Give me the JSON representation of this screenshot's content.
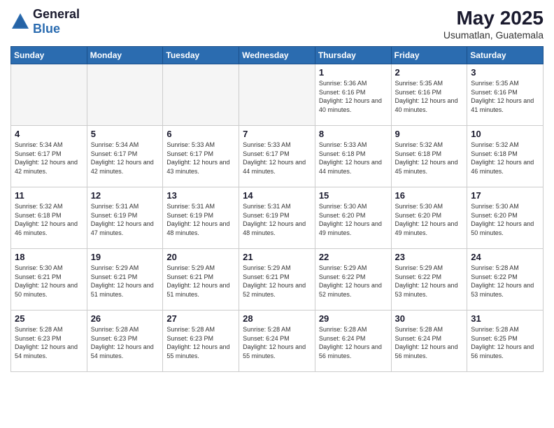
{
  "logo": {
    "general": "General",
    "blue": "Blue"
  },
  "header": {
    "title": "May 2025",
    "subtitle": "Usumatlan, Guatemala"
  },
  "days_of_week": [
    "Sunday",
    "Monday",
    "Tuesday",
    "Wednesday",
    "Thursday",
    "Friday",
    "Saturday"
  ],
  "weeks": [
    [
      {
        "day": "",
        "sunrise": "",
        "sunset": "",
        "daylight": ""
      },
      {
        "day": "",
        "sunrise": "",
        "sunset": "",
        "daylight": ""
      },
      {
        "day": "",
        "sunrise": "",
        "sunset": "",
        "daylight": ""
      },
      {
        "day": "",
        "sunrise": "",
        "sunset": "",
        "daylight": ""
      },
      {
        "day": "1",
        "sunrise": "Sunrise: 5:36 AM",
        "sunset": "Sunset: 6:16 PM",
        "daylight": "Daylight: 12 hours and 40 minutes."
      },
      {
        "day": "2",
        "sunrise": "Sunrise: 5:35 AM",
        "sunset": "Sunset: 6:16 PM",
        "daylight": "Daylight: 12 hours and 40 minutes."
      },
      {
        "day": "3",
        "sunrise": "Sunrise: 5:35 AM",
        "sunset": "Sunset: 6:16 PM",
        "daylight": "Daylight: 12 hours and 41 minutes."
      }
    ],
    [
      {
        "day": "4",
        "sunrise": "Sunrise: 5:34 AM",
        "sunset": "Sunset: 6:17 PM",
        "daylight": "Daylight: 12 hours and 42 minutes."
      },
      {
        "day": "5",
        "sunrise": "Sunrise: 5:34 AM",
        "sunset": "Sunset: 6:17 PM",
        "daylight": "Daylight: 12 hours and 42 minutes."
      },
      {
        "day": "6",
        "sunrise": "Sunrise: 5:33 AM",
        "sunset": "Sunset: 6:17 PM",
        "daylight": "Daylight: 12 hours and 43 minutes."
      },
      {
        "day": "7",
        "sunrise": "Sunrise: 5:33 AM",
        "sunset": "Sunset: 6:17 PM",
        "daylight": "Daylight: 12 hours and 44 minutes."
      },
      {
        "day": "8",
        "sunrise": "Sunrise: 5:33 AM",
        "sunset": "Sunset: 6:18 PM",
        "daylight": "Daylight: 12 hours and 44 minutes."
      },
      {
        "day": "9",
        "sunrise": "Sunrise: 5:32 AM",
        "sunset": "Sunset: 6:18 PM",
        "daylight": "Daylight: 12 hours and 45 minutes."
      },
      {
        "day": "10",
        "sunrise": "Sunrise: 5:32 AM",
        "sunset": "Sunset: 6:18 PM",
        "daylight": "Daylight: 12 hours and 46 minutes."
      }
    ],
    [
      {
        "day": "11",
        "sunrise": "Sunrise: 5:32 AM",
        "sunset": "Sunset: 6:18 PM",
        "daylight": "Daylight: 12 hours and 46 minutes."
      },
      {
        "day": "12",
        "sunrise": "Sunrise: 5:31 AM",
        "sunset": "Sunset: 6:19 PM",
        "daylight": "Daylight: 12 hours and 47 minutes."
      },
      {
        "day": "13",
        "sunrise": "Sunrise: 5:31 AM",
        "sunset": "Sunset: 6:19 PM",
        "daylight": "Daylight: 12 hours and 48 minutes."
      },
      {
        "day": "14",
        "sunrise": "Sunrise: 5:31 AM",
        "sunset": "Sunset: 6:19 PM",
        "daylight": "Daylight: 12 hours and 48 minutes."
      },
      {
        "day": "15",
        "sunrise": "Sunrise: 5:30 AM",
        "sunset": "Sunset: 6:20 PM",
        "daylight": "Daylight: 12 hours and 49 minutes."
      },
      {
        "day": "16",
        "sunrise": "Sunrise: 5:30 AM",
        "sunset": "Sunset: 6:20 PM",
        "daylight": "Daylight: 12 hours and 49 minutes."
      },
      {
        "day": "17",
        "sunrise": "Sunrise: 5:30 AM",
        "sunset": "Sunset: 6:20 PM",
        "daylight": "Daylight: 12 hours and 50 minutes."
      }
    ],
    [
      {
        "day": "18",
        "sunrise": "Sunrise: 5:30 AM",
        "sunset": "Sunset: 6:21 PM",
        "daylight": "Daylight: 12 hours and 50 minutes."
      },
      {
        "day": "19",
        "sunrise": "Sunrise: 5:29 AM",
        "sunset": "Sunset: 6:21 PM",
        "daylight": "Daylight: 12 hours and 51 minutes."
      },
      {
        "day": "20",
        "sunrise": "Sunrise: 5:29 AM",
        "sunset": "Sunset: 6:21 PM",
        "daylight": "Daylight: 12 hours and 51 minutes."
      },
      {
        "day": "21",
        "sunrise": "Sunrise: 5:29 AM",
        "sunset": "Sunset: 6:21 PM",
        "daylight": "Daylight: 12 hours and 52 minutes."
      },
      {
        "day": "22",
        "sunrise": "Sunrise: 5:29 AM",
        "sunset": "Sunset: 6:22 PM",
        "daylight": "Daylight: 12 hours and 52 minutes."
      },
      {
        "day": "23",
        "sunrise": "Sunrise: 5:29 AM",
        "sunset": "Sunset: 6:22 PM",
        "daylight": "Daylight: 12 hours and 53 minutes."
      },
      {
        "day": "24",
        "sunrise": "Sunrise: 5:28 AM",
        "sunset": "Sunset: 6:22 PM",
        "daylight": "Daylight: 12 hours and 53 minutes."
      }
    ],
    [
      {
        "day": "25",
        "sunrise": "Sunrise: 5:28 AM",
        "sunset": "Sunset: 6:23 PM",
        "daylight": "Daylight: 12 hours and 54 minutes."
      },
      {
        "day": "26",
        "sunrise": "Sunrise: 5:28 AM",
        "sunset": "Sunset: 6:23 PM",
        "daylight": "Daylight: 12 hours and 54 minutes."
      },
      {
        "day": "27",
        "sunrise": "Sunrise: 5:28 AM",
        "sunset": "Sunset: 6:23 PM",
        "daylight": "Daylight: 12 hours and 55 minutes."
      },
      {
        "day": "28",
        "sunrise": "Sunrise: 5:28 AM",
        "sunset": "Sunset: 6:24 PM",
        "daylight": "Daylight: 12 hours and 55 minutes."
      },
      {
        "day": "29",
        "sunrise": "Sunrise: 5:28 AM",
        "sunset": "Sunset: 6:24 PM",
        "daylight": "Daylight: 12 hours and 56 minutes."
      },
      {
        "day": "30",
        "sunrise": "Sunrise: 5:28 AM",
        "sunset": "Sunset: 6:24 PM",
        "daylight": "Daylight: 12 hours and 56 minutes."
      },
      {
        "day": "31",
        "sunrise": "Sunrise: 5:28 AM",
        "sunset": "Sunset: 6:25 PM",
        "daylight": "Daylight: 12 hours and 56 minutes."
      }
    ]
  ]
}
